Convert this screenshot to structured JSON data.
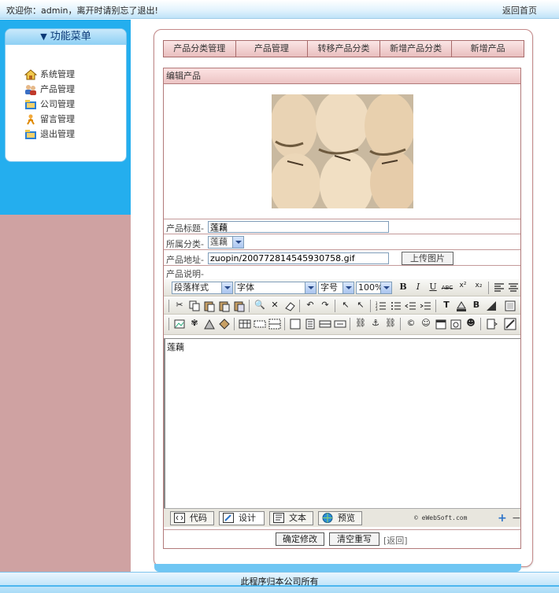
{
  "header": {
    "welcome": "欢迎你：admin，离开时请别忘了退出!",
    "home_link": "返回首页"
  },
  "sidebar": {
    "title": "功能菜单",
    "items": [
      {
        "label": "系统管理",
        "icon": "house-icon"
      },
      {
        "label": "产品管理",
        "icon": "users-icon"
      },
      {
        "label": "公司管理",
        "icon": "folder-icon"
      },
      {
        "label": "留言管理",
        "icon": "person-icon"
      },
      {
        "label": "退出管理",
        "icon": "exit-folder-icon"
      }
    ]
  },
  "tabs": [
    "产品分类管理",
    "产品管理",
    "转移产品分类",
    "新增产品分类",
    "新增产品"
  ],
  "form": {
    "section_title": "编辑产品",
    "title_label": "产品标题-",
    "title_value": "莲藕",
    "category_label": "所属分类-",
    "category_value": "莲藕",
    "address_label": "产品地址-",
    "address_value": "zuopin/200772814545930758.gif",
    "upload_label": "上传图片",
    "desc_label": "产品说明-"
  },
  "editor": {
    "paragraph_style": "段落样式",
    "font": "字体",
    "font_size": "字号",
    "zoom": "100%",
    "content": "莲藕",
    "modes": [
      "代码",
      "设计",
      "文本",
      "预览"
    ],
    "copyright": "© eWebSoft.com"
  },
  "actions": {
    "confirm": "确定修改",
    "reset": "清空重写",
    "back": "[返回]"
  },
  "footer": {
    "text": "此程序归本公司所有"
  },
  "colors": {
    "sidebar_blue": "#24aeee",
    "sidebar_pink": "#cfa2a2",
    "tab_border": "#a86b6b"
  }
}
